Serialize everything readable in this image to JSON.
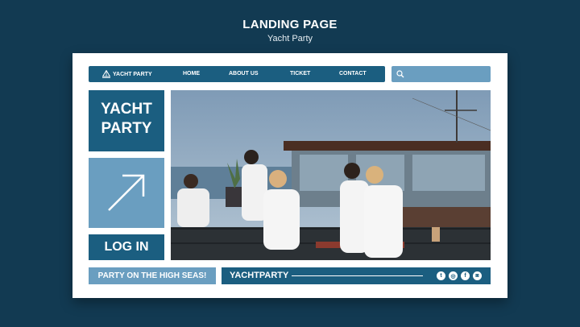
{
  "page": {
    "title": "LANDING PAGE",
    "subtitle": "Yacht Party"
  },
  "nav": {
    "brand": "YACHT PARTY",
    "links": [
      "HOME",
      "ABOUT US",
      "TICKET",
      "CONTACT"
    ]
  },
  "search": {
    "icon": "search-icon"
  },
  "tiles": {
    "yacht_line1": "YACHT",
    "yacht_line2": "PARTY",
    "login": "LOG IN",
    "arrow_icon": "arrow-up-right-icon"
  },
  "bottom": {
    "tagline": "PARTY ON THE HIGH SEAS!",
    "footer_brand": "YACHTPARTY"
  },
  "social": [
    {
      "icon": "twitter-icon",
      "glyph": "t"
    },
    {
      "icon": "dribbble-icon",
      "glyph": "◎"
    },
    {
      "icon": "facebook-icon",
      "glyph": "f"
    },
    {
      "icon": "instagram-icon",
      "glyph": "◙"
    }
  ],
  "colors": {
    "background": "#123a52",
    "primary": "#1b5e80",
    "secondary": "#6a9ec0",
    "card": "#ffffff"
  }
}
